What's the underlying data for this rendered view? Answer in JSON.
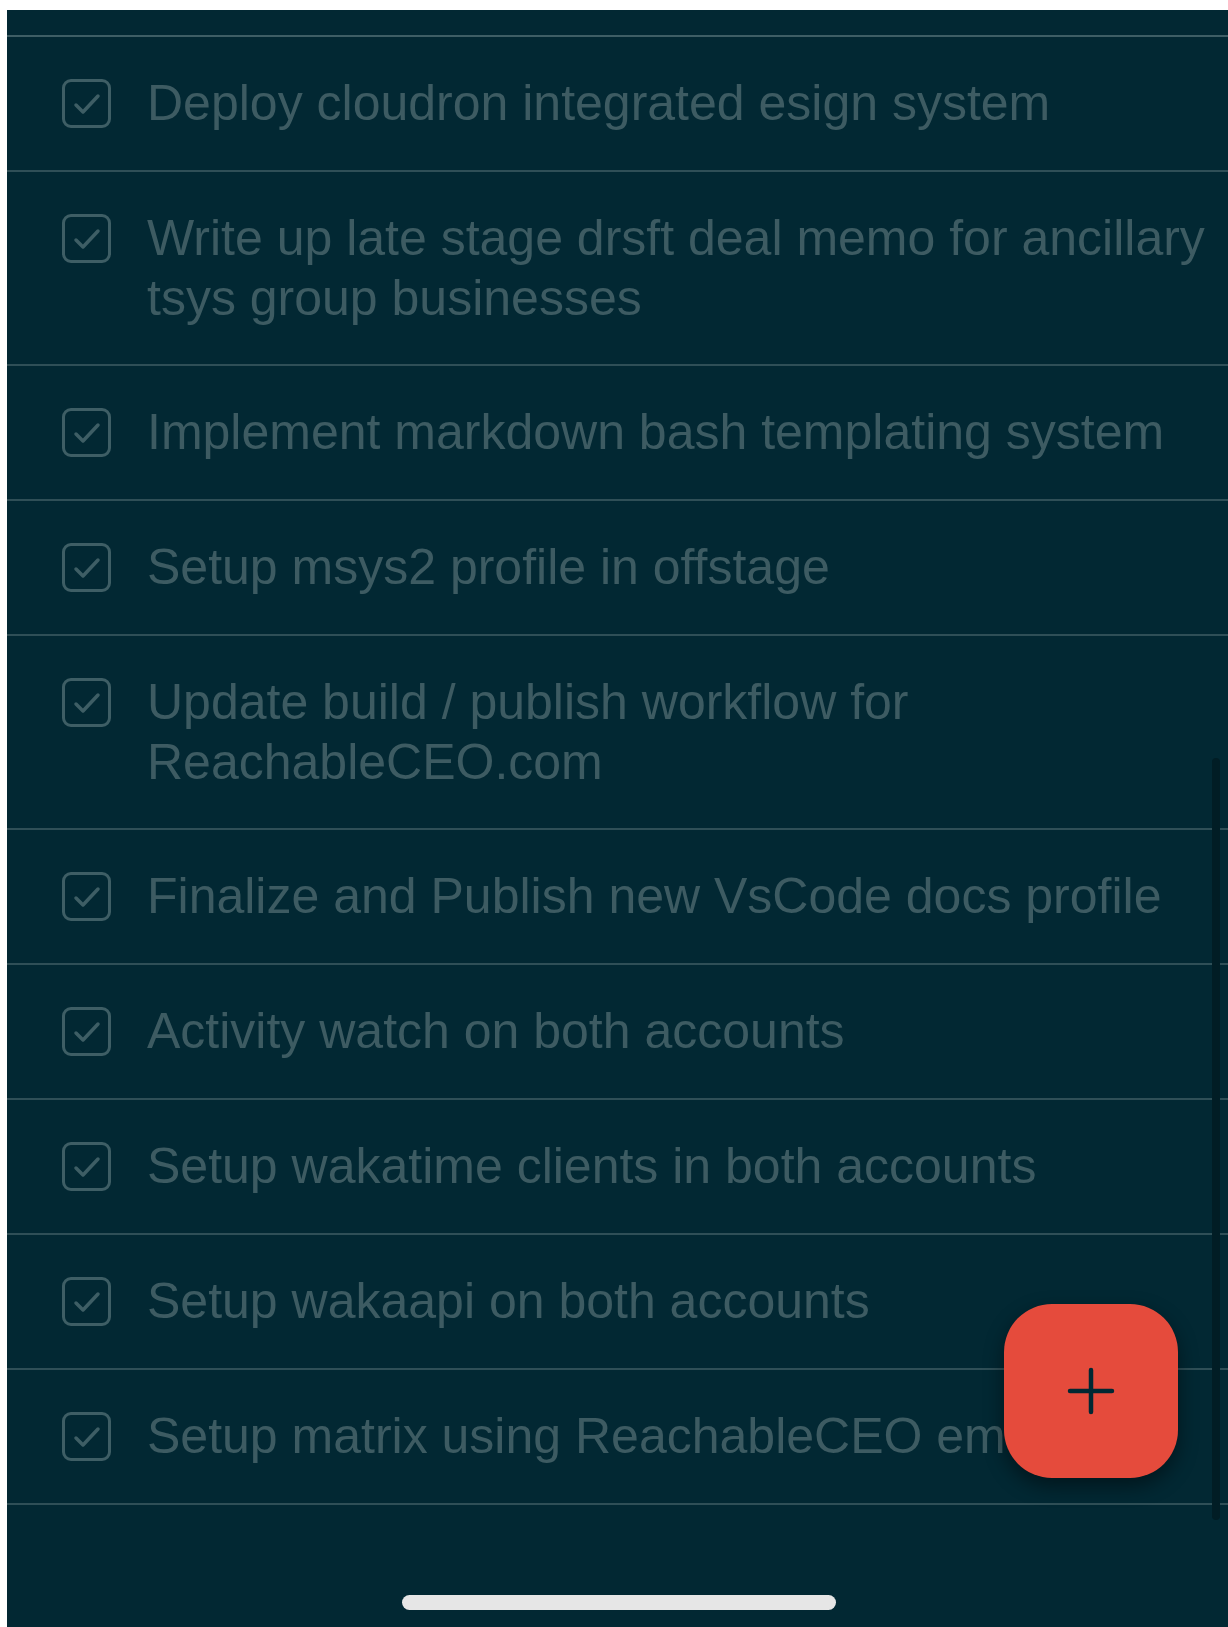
{
  "tasks": [
    {
      "text": "Deploy cloudron integrated esign system",
      "checked": true
    },
    {
      "text": "Write up late stage drsft deal memo for ancillary tsys group businesses",
      "checked": true
    },
    {
      "text": "Implement markdown bash templating system",
      "checked": true
    },
    {
      "text": "Setup msys2 profile in offstage",
      "checked": true
    },
    {
      "text": "Update build / publish workflow for ReachableCEO.com",
      "checked": true
    },
    {
      "text": "Finalize and Publish new VsCode docs profile",
      "checked": true
    },
    {
      "text": "Activity watch on both accounts",
      "checked": true
    },
    {
      "text": "Setup wakatime clients in both accounts",
      "checked": true
    },
    {
      "text": "Setup wakaapi on both accounts",
      "checked": true
    },
    {
      "text": "Setup matrix using ReachableCEO em",
      "checked": true
    }
  ]
}
